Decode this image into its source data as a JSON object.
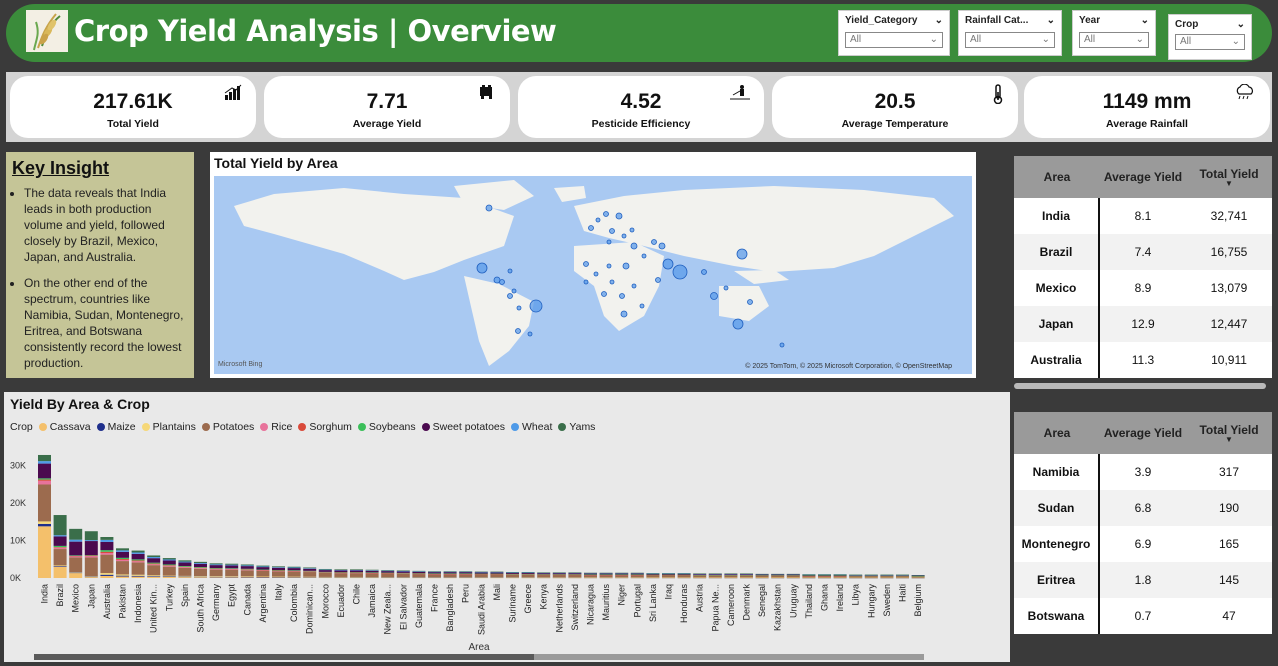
{
  "header": {
    "title": "Crop Yield Analysis | Overview",
    "slicers": [
      {
        "label": "Yield_Category",
        "value": "All"
      },
      {
        "label": "Rainfall Cat...",
        "value": "All"
      },
      {
        "label": "Year",
        "value": "All"
      },
      {
        "label": "Crop",
        "value": "All"
      }
    ]
  },
  "kpis": [
    {
      "value": "217.61K",
      "label": "Total Yield",
      "icon": "bar-chart-icon"
    },
    {
      "value": "7.71",
      "label": "Average Yield",
      "icon": "tractor-icon"
    },
    {
      "value": "4.52",
      "label": "Pesticide Efficiency",
      "icon": "farmer-sprayer-icon"
    },
    {
      "value": "20.5",
      "label": "Average Temperature",
      "icon": "thermometer-icon"
    },
    {
      "value": "1149 mm",
      "label": "Average Rainfall",
      "icon": "rain-cloud-icon"
    }
  ],
  "insight": {
    "title": "Key Insight",
    "points": [
      "The data reveals that India leads in both production volume and yield, followed closely by Brazil, Mexico, Japan, and Australia.",
      "On the other end of the spectrum, countries like Namibia, Sudan, Montenegro, Eritrea, and Botswana consistently record the lowest production."
    ]
  },
  "map": {
    "title": "Total Yield by Area",
    "credit": "© 2025 TomTom, © 2025 Microsoft Corporation, © OpenStreetMap",
    "bing": "Microsoft Bing"
  },
  "table_top": {
    "headers": [
      "Area",
      "Average Yield",
      "Total Yield"
    ],
    "rows": [
      [
        "India",
        "8.1",
        "32,741"
      ],
      [
        "Brazil",
        "7.4",
        "16,755"
      ],
      [
        "Mexico",
        "8.9",
        "13,079"
      ],
      [
        "Japan",
        "12.9",
        "12,447"
      ],
      [
        "Australia",
        "11.3",
        "10,911"
      ]
    ]
  },
  "table_bottom": {
    "headers": [
      "Area",
      "Average Yield",
      "Total Yield"
    ],
    "rows": [
      [
        "Namibia",
        "3.9",
        "317"
      ],
      [
        "Sudan",
        "6.8",
        "190"
      ],
      [
        "Montenegro",
        "6.9",
        "165"
      ],
      [
        "Eritrea",
        "1.8",
        "145"
      ],
      [
        "Botswana",
        "0.7",
        "47"
      ]
    ]
  },
  "chart_title": "Yield By Area & Crop",
  "chart_data": {
    "type": "bar",
    "stacked": true,
    "xlabel": "Area",
    "ylabel": "",
    "ylim": [
      0,
      33000
    ],
    "yticks": [
      "0K",
      "10K",
      "20K",
      "30K"
    ],
    "legend_title": "Crop",
    "crops": [
      {
        "name": "Cassava",
        "color": "#f4c06b"
      },
      {
        "name": "Maize",
        "color": "#1f2f8c"
      },
      {
        "name": "Plantains",
        "color": "#f6d878"
      },
      {
        "name": "Potatoes",
        "color": "#9c6b4e"
      },
      {
        "name": "Rice",
        "color": "#e8739b"
      },
      {
        "name": "Sorghum",
        "color": "#d94a3a"
      },
      {
        "name": "Soybeans",
        "color": "#3bbf5a"
      },
      {
        "name": "Sweet potatoes",
        "color": "#4b0a4f"
      },
      {
        "name": "Wheat",
        "color": "#4e9ae8"
      },
      {
        "name": "Yams",
        "color": "#3a6e4a"
      }
    ],
    "categories": [
      "India",
      "Brazil",
      "Mexico",
      "Japan",
      "Australia",
      "Pakistan",
      "Indonesia",
      "United Kin...",
      "Turkey",
      "Spain",
      "South Africa",
      "Germany",
      "Egypt",
      "Canada",
      "Argentina",
      "Italy",
      "Colombia",
      "Dominican...",
      "Morocco",
      "Ecuador",
      "Chile",
      "Jamaica",
      "New Zeala...",
      "El Salvador",
      "Guatemala",
      "France",
      "Bangladesh",
      "Peru",
      "Saudi Arabia",
      "Mali",
      "Suriname",
      "Greece",
      "Kenya",
      "Netherlands",
      "Switzerland",
      "Nicaragua",
      "Mauritius",
      "Niger",
      "Portugal",
      "Sri Lanka",
      "Iraq",
      "Honduras",
      "Austria",
      "Papua Ne...",
      "Cameroon",
      "Denmark",
      "Senegal",
      "Kazakhstan",
      "Uruguay",
      "Thailand",
      "Ghana",
      "Ireland",
      "Libya",
      "Hungary",
      "Sweden",
      "Haiti",
      "Belgium"
    ],
    "totals": [
      32741,
      16755,
      13079,
      12447,
      10911,
      7900,
      7300,
      6000,
      5300,
      4700,
      4300,
      3900,
      3800,
      3600,
      3300,
      3100,
      3000,
      2800,
      2400,
      2300,
      2300,
      2200,
      2100,
      2000,
      1900,
      1800,
      1800,
      1800,
      1700,
      1700,
      1600,
      1600,
      1500,
      1500,
      1500,
      1400,
      1400,
      1400,
      1400,
      1300,
      1300,
      1300,
      1200,
      1200,
      1200,
      1200,
      1100,
      1100,
      1100,
      1000,
      1000,
      1000,
      900,
      900,
      900,
      900,
      800
    ]
  }
}
